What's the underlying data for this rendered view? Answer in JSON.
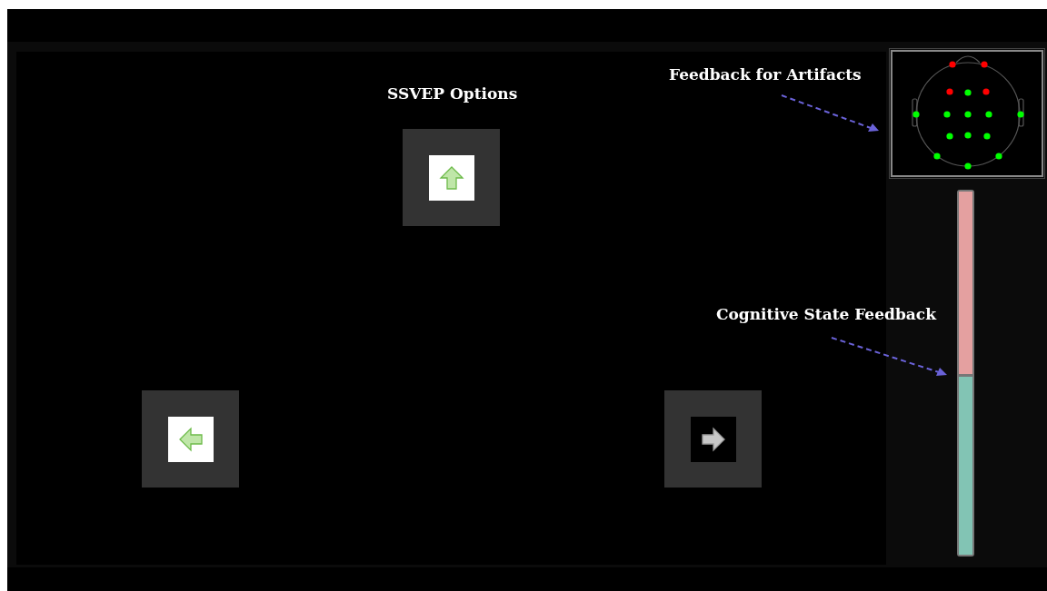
{
  "ssvep_options": {
    "label": "SSVEP Options",
    "items": [
      {
        "kind": "up",
        "highlighted": true
      },
      {
        "kind": "left",
        "highlighted": true
      },
      {
        "kind": "right",
        "highlighted": false
      }
    ]
  },
  "artifact_feedback": {
    "label": "Feedback for Artifacts",
    "electrodes": [
      {
        "color": "#ff0000"
      },
      {
        "color": "#ff0000"
      },
      {
        "color": "#ff0000"
      },
      {
        "color": "#00ff00"
      },
      {
        "color": "#ff0000"
      },
      {
        "color": "#00ff00"
      },
      {
        "color": "#00ff00"
      },
      {
        "color": "#00ff00"
      },
      {
        "color": "#00ff00"
      },
      {
        "color": "#00ff00"
      },
      {
        "color": "#00ff00"
      },
      {
        "color": "#00ff00"
      },
      {
        "color": "#00ff00"
      },
      {
        "color": "#00ff00"
      },
      {
        "color": "#00ff00"
      },
      {
        "color": "#00ff00"
      }
    ]
  },
  "cognitive_state": {
    "label": "Cognitive State Feedback",
    "level": 0.49
  }
}
